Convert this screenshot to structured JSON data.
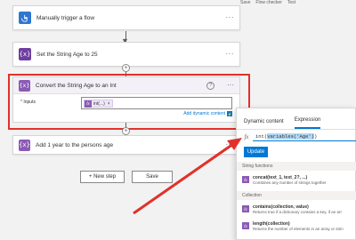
{
  "topbar": {
    "save": "Save",
    "checker": "Flow checker",
    "test": "Test"
  },
  "steps": {
    "trigger": {
      "title": "Manually trigger a flow",
      "icon": "hand-tap-icon",
      "color": "#2e77d0"
    },
    "set_var": {
      "title": "Set the String Age to 25",
      "icon": "variable-icon",
      "color": "#6e3ea0"
    },
    "convert": {
      "title": "Convert the String Age to an Int",
      "inputs_label": "Inputs",
      "required_mark": "*",
      "token_label": "int(...)",
      "token_remove": "×",
      "add_dynamic": "Add dynamic content"
    },
    "add_year": {
      "title": "Add 1 year to the persons age",
      "icon": "variable-icon",
      "color": "#8a5bb4"
    }
  },
  "buttons": {
    "new_step": "+ New step",
    "save": "Save"
  },
  "panel": {
    "tabs": [
      "Dynamic content",
      "Expression"
    ],
    "expression_prefix": "int(",
    "expression_selected": "variables('Age')",
    "expression_suffix": ")",
    "update": "Update",
    "sections": [
      "String functions",
      "Collection"
    ],
    "functions": [
      {
        "name": "concat(text_1, text_2?, ...)",
        "desc": "Combines any number of strings together"
      },
      {
        "name": "contains(collection, value)",
        "desc": "Returns true if a dictionary contains a key, if an arr"
      },
      {
        "name": "length(collection)",
        "desc": "Returns the number of elements in an array or strin"
      }
    ]
  },
  "colors": {
    "accent": "#0078d4",
    "highlight": "#e2312b",
    "expression": "#8a5bb4"
  }
}
